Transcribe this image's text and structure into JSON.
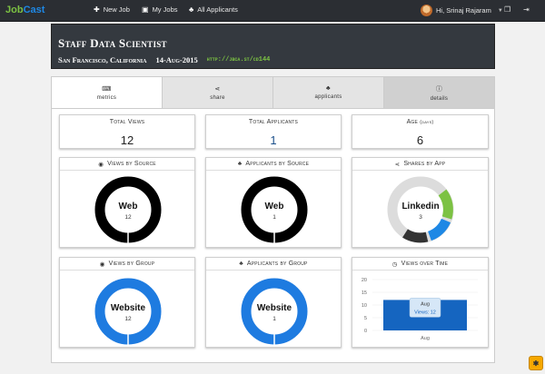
{
  "app": {
    "brand_part1": "Job",
    "brand_part2": "Cast"
  },
  "nav": {
    "new_job": "New Job",
    "my_jobs": "My Jobs",
    "all_applicants": "All Applicants",
    "user_greeting": "Hi, Srinaj Rajaram",
    "icons": [
      "plus-icon",
      "briefcase-icon",
      "users-icon",
      "chevron-down-icon",
      "copy-icon",
      "logout-icon"
    ]
  },
  "job": {
    "title": "Staff Data Scientist",
    "location": "San Francisco, California",
    "date": "14-Aug-2015",
    "link": "http://jbca.st/cd144"
  },
  "tabs": [
    {
      "label": "metrics",
      "icon": "keyboard-icon"
    },
    {
      "label": "share",
      "icon": "share-icon"
    },
    {
      "label": "applicants",
      "icon": "users-icon"
    },
    {
      "label": "details",
      "icon": "info-icon"
    }
  ],
  "stats": {
    "total_views_label": "Total Views",
    "total_views": "12",
    "total_applicants_label": "Total Applicants",
    "total_applicants": "1",
    "age_label": "Age",
    "age_unit": "(days)",
    "age": "6"
  },
  "charts": {
    "views_by_source": {
      "title": "Views by Source",
      "label": "Web",
      "value": "12",
      "color": "#000000"
    },
    "applicants_by_source": {
      "title": "Applicants by Source",
      "label": "Web",
      "value": "1",
      "color": "#000000"
    },
    "shares_by_app": {
      "title": "Shares by App",
      "label": "Linkedin",
      "value": "3"
    },
    "views_by_group": {
      "title": "Views by Group",
      "label": "Website",
      "value": "12",
      "color": "#1e7be0"
    },
    "applicants_by_group": {
      "title": "Applicants by Group",
      "label": "Website",
      "value": "1",
      "color": "#1e7be0"
    },
    "views_over_time": {
      "title": "Views over Time",
      "tooltip_title": "Aug",
      "tooltip_value": "Views: 12"
    }
  },
  "chart_data": [
    {
      "type": "pie",
      "title": "Views by Source",
      "categories": [
        "Web"
      ],
      "values": [
        12
      ]
    },
    {
      "type": "pie",
      "title": "Applicants by Source",
      "categories": [
        "Web"
      ],
      "values": [
        1
      ]
    },
    {
      "type": "pie",
      "title": "Shares by App",
      "categories": [
        "Linkedin"
      ],
      "values": [
        3
      ]
    },
    {
      "type": "pie",
      "title": "Views by Group",
      "categories": [
        "Website"
      ],
      "values": [
        12
      ]
    },
    {
      "type": "pie",
      "title": "Applicants by Group",
      "categories": [
        "Website"
      ],
      "values": [
        1
      ]
    },
    {
      "type": "bar",
      "title": "Views over Time",
      "categories": [
        "Aug"
      ],
      "values": [
        12
      ],
      "ylim": [
        0,
        20
      ],
      "yticks": [
        0,
        5,
        10,
        15,
        20
      ],
      "color": "#1565c0"
    }
  ]
}
